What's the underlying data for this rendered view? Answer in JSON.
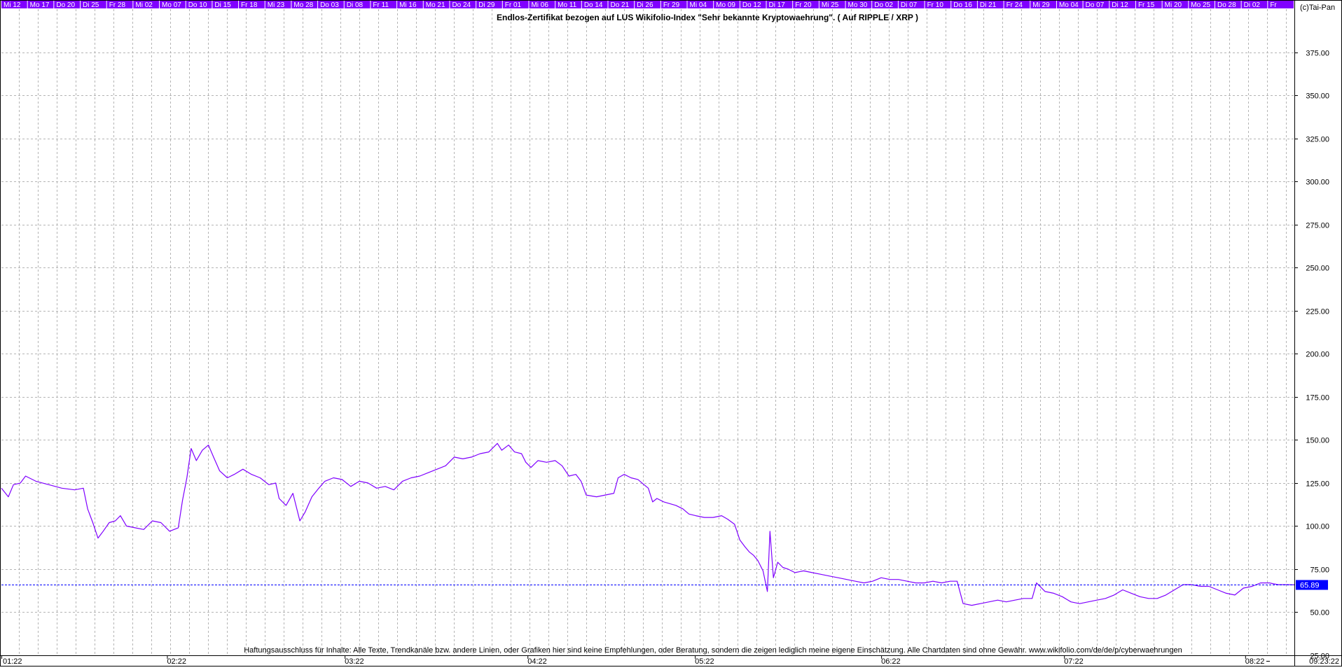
{
  "top_date_strip": [
    "Mi 12",
    "Mo 17",
    "Do 20",
    "Di 25",
    "Fr 28",
    "Mi 02",
    "Mo 07",
    "Do 10",
    "Di 15",
    "Fr 18",
    "Mi 23",
    "Mo 28",
    "Do 03",
    "Di 08",
    "Fr 11",
    "Mi 16",
    "Mo 21",
    "Do 24",
    "Di 29",
    "Fr 01",
    "Mi 06",
    "Mo 11",
    "Do 14",
    "Do 21",
    "Di 26",
    "Fr 29",
    "Mi 04",
    "Mo 09",
    "Do 12",
    "Di 17",
    "Fr 20",
    "Mi 25",
    "Mo 30",
    "Do 02",
    "Di 07",
    "Fr 10",
    "Do 16",
    "Di 21",
    "Fr 24",
    "Mi 29",
    "Mo 04",
    "Do 07",
    "Di 12",
    "Fr 15",
    "Mi 20",
    "Mo 25",
    "Do 28",
    "Di 02",
    "Fr"
  ],
  "copyright": "(c)Tai-Pan",
  "last_value_label": "65.89",
  "time_label": "09:23:22",
  "disclaimer": "Haftungsausschluss für Inhalte: Alle Texte, Trendkanäle bzw. andere Linien, oder Grafiken hier sind keine Empfehlungen, oder Beratung, sondern die zeigen lediglich meine eigene Einschätzung. Alle Chartdaten sind ohne Gewähr.  www.wikifolio.com/de/de/p/cyberwaehrungen",
  "colors": {
    "series": "#7f00ff",
    "strip_bg": "#8000ff",
    "strip_text": "#ffffff",
    "grid": "#b4b4b4",
    "last_line": "#0000ff",
    "last_label_bg": "#0000ff"
  },
  "chart_data": {
    "type": "line",
    "title": "Endlos-Zertifikat bezogen auf LUS Wikifolio-Index \"Sehr bekannte Kryptowaehrung\". ( Auf RIPPLE / XRP )",
    "xlabel": "",
    "ylabel": "",
    "ylim": [
      25,
      400
    ],
    "xlim": [
      0,
      1499
    ],
    "yticks": [
      25,
      50,
      75,
      100,
      125,
      150,
      175,
      200,
      225,
      250,
      275,
      300,
      325,
      350,
      375
    ],
    "ytick_labels": [
      "25.00",
      "50.00",
      "75.00",
      "100.00",
      "125.00",
      "150.00",
      "175.00",
      "200.00",
      "225.00",
      "250.00",
      "275.00",
      "300.00",
      "325.00",
      "350.00",
      "375.00"
    ],
    "x_month_labels": [
      {
        "label": "01:22",
        "x": 0
      },
      {
        "label": "02:22",
        "x": 192
      },
      {
        "label": "03:22",
        "x": 398
      },
      {
        "label": "04:22",
        "x": 610
      },
      {
        "label": "05:22",
        "x": 804
      },
      {
        "label": "06:22",
        "x": 1020
      },
      {
        "label": "07:22",
        "x": 1232
      },
      {
        "label": "08:22",
        "x": 1442
      }
    ],
    "last_value": 65.89,
    "grid": true,
    "series": [
      {
        "points": [
          [
            0,
            122
          ],
          [
            8,
            117
          ],
          [
            14,
            124
          ],
          [
            22,
            125
          ],
          [
            28,
            129
          ],
          [
            40,
            126
          ],
          [
            55,
            124
          ],
          [
            70,
            122
          ],
          [
            85,
            121
          ],
          [
            95,
            122
          ],
          [
            100,
            110
          ],
          [
            106,
            102
          ],
          [
            112,
            93
          ],
          [
            118,
            97
          ],
          [
            125,
            102
          ],
          [
            132,
            103
          ],
          [
            138,
            106
          ],
          [
            145,
            100
          ],
          [
            155,
            99
          ],
          [
            165,
            98
          ],
          [
            175,
            103
          ],
          [
            185,
            102
          ],
          [
            195,
            97
          ],
          [
            205,
            99
          ],
          [
            210,
            115
          ],
          [
            215,
            128
          ],
          [
            220,
            145
          ],
          [
            226,
            138
          ],
          [
            233,
            144
          ],
          [
            240,
            147
          ],
          [
            246,
            140
          ],
          [
            253,
            132
          ],
          [
            262,
            128
          ],
          [
            270,
            130
          ],
          [
            280,
            133
          ],
          [
            290,
            130
          ],
          [
            300,
            128
          ],
          [
            310,
            124
          ],
          [
            318,
            125
          ],
          [
            322,
            116
          ],
          [
            330,
            112
          ],
          [
            338,
            119
          ],
          [
            346,
            103
          ],
          [
            352,
            108
          ],
          [
            360,
            117
          ],
          [
            368,
            122
          ],
          [
            375,
            126
          ],
          [
            385,
            128
          ],
          [
            395,
            127
          ],
          [
            405,
            123
          ],
          [
            415,
            126
          ],
          [
            425,
            125
          ],
          [
            435,
            122
          ],
          [
            445,
            123
          ],
          [
            455,
            121
          ],
          [
            465,
            126
          ],
          [
            475,
            128
          ],
          [
            485,
            129
          ],
          [
            495,
            131
          ],
          [
            505,
            133
          ],
          [
            515,
            135
          ],
          [
            525,
            140
          ],
          [
            535,
            139
          ],
          [
            545,
            140
          ],
          [
            555,
            142
          ],
          [
            565,
            143
          ],
          [
            575,
            148
          ],
          [
            580,
            144
          ],
          [
            588,
            147
          ],
          [
            595,
            143
          ],
          [
            603,
            142
          ],
          [
            608,
            137
          ],
          [
            614,
            134
          ],
          [
            622,
            138
          ],
          [
            632,
            137
          ],
          [
            642,
            138
          ],
          [
            650,
            135
          ],
          [
            658,
            129
          ],
          [
            666,
            130
          ],
          [
            672,
            126
          ],
          [
            678,
            118
          ],
          [
            690,
            117
          ],
          [
            700,
            118
          ],
          [
            710,
            119
          ],
          [
            715,
            128
          ],
          [
            722,
            130
          ],
          [
            730,
            128
          ],
          [
            738,
            127
          ],
          [
            745,
            124
          ],
          [
            750,
            122
          ],
          [
            755,
            114
          ],
          [
            760,
            116
          ],
          [
            768,
            114
          ],
          [
            775,
            113
          ],
          [
            782,
            112
          ],
          [
            790,
            110
          ],
          [
            797,
            107
          ],
          [
            805,
            106
          ],
          [
            815,
            105
          ],
          [
            825,
            105
          ],
          [
            835,
            106
          ],
          [
            842,
            104
          ],
          [
            850,
            101
          ],
          [
            856,
            92
          ],
          [
            862,
            88
          ],
          [
            867,
            85
          ],
          [
            872,
            83
          ],
          [
            877,
            80
          ],
          [
            883,
            74
          ],
          [
            888,
            62
          ],
          [
            891,
            97
          ],
          [
            895,
            70
          ],
          [
            900,
            79
          ],
          [
            906,
            76
          ],
          [
            912,
            75
          ],
          [
            920,
            73
          ],
          [
            930,
            74
          ],
          [
            940,
            73
          ],
          [
            950,
            72
          ],
          [
            960,
            71
          ],
          [
            970,
            70
          ],
          [
            980,
            69
          ],
          [
            990,
            68
          ],
          [
            1000,
            67
          ],
          [
            1010,
            68
          ],
          [
            1020,
            70
          ],
          [
            1030,
            69
          ],
          [
            1040,
            69
          ],
          [
            1050,
            68
          ],
          [
            1060,
            67
          ],
          [
            1070,
            67
          ],
          [
            1080,
            68
          ],
          [
            1090,
            67
          ],
          [
            1100,
            68
          ],
          [
            1108,
            68
          ],
          [
            1115,
            55
          ],
          [
            1125,
            54
          ],
          [
            1135,
            55
          ],
          [
            1145,
            56
          ],
          [
            1155,
            57
          ],
          [
            1165,
            56
          ],
          [
            1175,
            57
          ],
          [
            1185,
            58
          ],
          [
            1195,
            58
          ],
          [
            1200,
            67
          ],
          [
            1210,
            62
          ],
          [
            1220,
            61
          ],
          [
            1230,
            59
          ],
          [
            1240,
            56
          ],
          [
            1250,
            55
          ],
          [
            1260,
            56
          ],
          [
            1270,
            57
          ],
          [
            1280,
            58
          ],
          [
            1290,
            60
          ],
          [
            1300,
            63
          ],
          [
            1310,
            61
          ],
          [
            1320,
            59
          ],
          [
            1330,
            58
          ],
          [
            1340,
            58
          ],
          [
            1350,
            60
          ],
          [
            1360,
            63
          ],
          [
            1370,
            66
          ],
          [
            1380,
            66
          ],
          [
            1390,
            65
          ],
          [
            1400,
            65
          ],
          [
            1410,
            63
          ],
          [
            1420,
            61
          ],
          [
            1430,
            60
          ],
          [
            1440,
            64
          ],
          [
            1450,
            65
          ],
          [
            1460,
            67
          ],
          [
            1470,
            67
          ],
          [
            1480,
            66
          ],
          [
            1490,
            66
          ],
          [
            1499,
            65.89
          ]
        ]
      }
    ]
  }
}
